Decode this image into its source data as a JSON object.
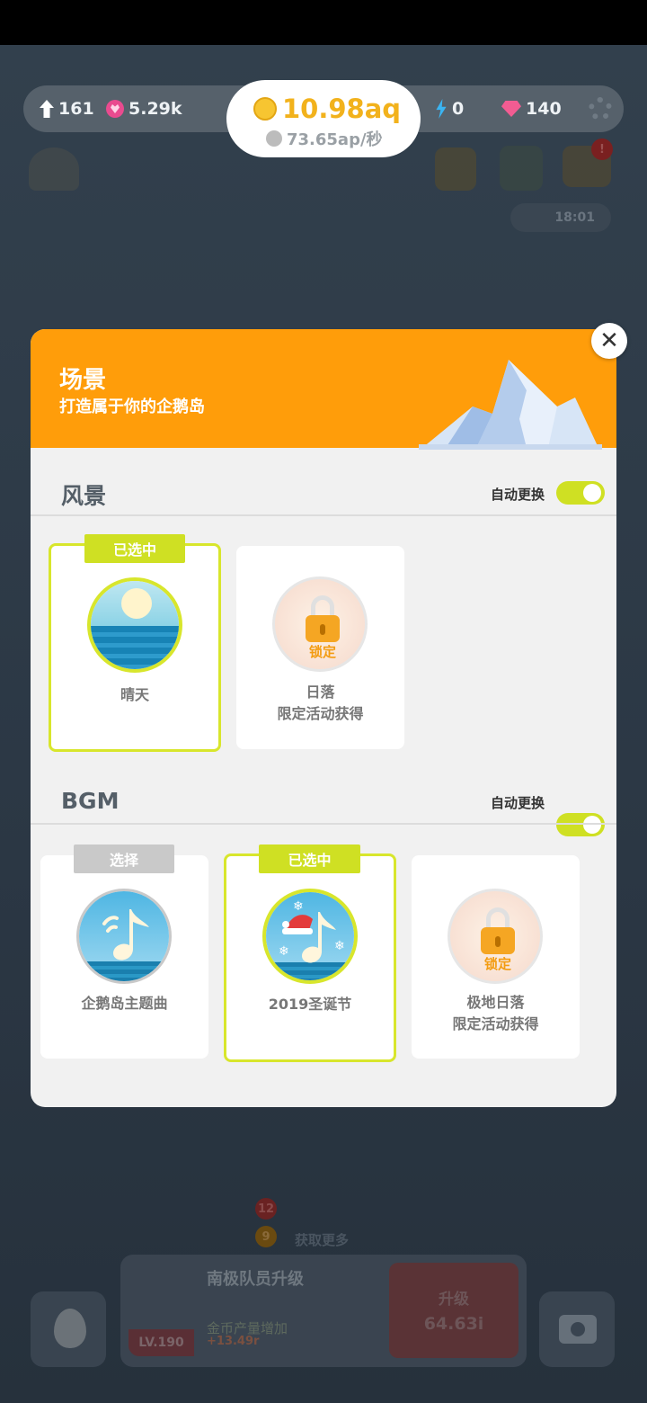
{
  "hud": {
    "penguins": "161",
    "hearts": "5.29k",
    "coins": "10.98aq",
    "coin_rate": "73.65ap/秒",
    "energy": "0",
    "diamonds": "140",
    "timer": "18:01",
    "badge_red": "12",
    "badge_orange": "9",
    "more_label": "获取更多"
  },
  "bottom": {
    "title": "南极队员升级",
    "subtitle": "金币产量增加",
    "delta": "+13.49r",
    "level": "LV.190",
    "upgrade_label": "升级",
    "upgrade_cost": "64.63i"
  },
  "modal": {
    "title": "场景",
    "subtitle": "打造属于你的企鹅岛",
    "scenery": {
      "title": "风景",
      "auto_label": "自动更换",
      "auto_on": true,
      "items": [
        {
          "name": "晴天",
          "status": "已选中"
        },
        {
          "name": "日落",
          "note": "限定活动获得",
          "lock_text": "锁定"
        }
      ]
    },
    "bgm": {
      "title": "BGM",
      "auto_label": "自动更换",
      "auto_on": true,
      "items": [
        {
          "name": "企鹅岛主题曲",
          "status": "选择"
        },
        {
          "name": "2019圣诞节",
          "status": "已选中"
        },
        {
          "name": "极地日落",
          "note": "限定活动获得",
          "lock_text": "锁定"
        }
      ]
    }
  },
  "colors": {
    "header": "#ff9d0a",
    "selected": "#cfe023",
    "coin": "#f2b21c",
    "lock": "#f5a623"
  }
}
